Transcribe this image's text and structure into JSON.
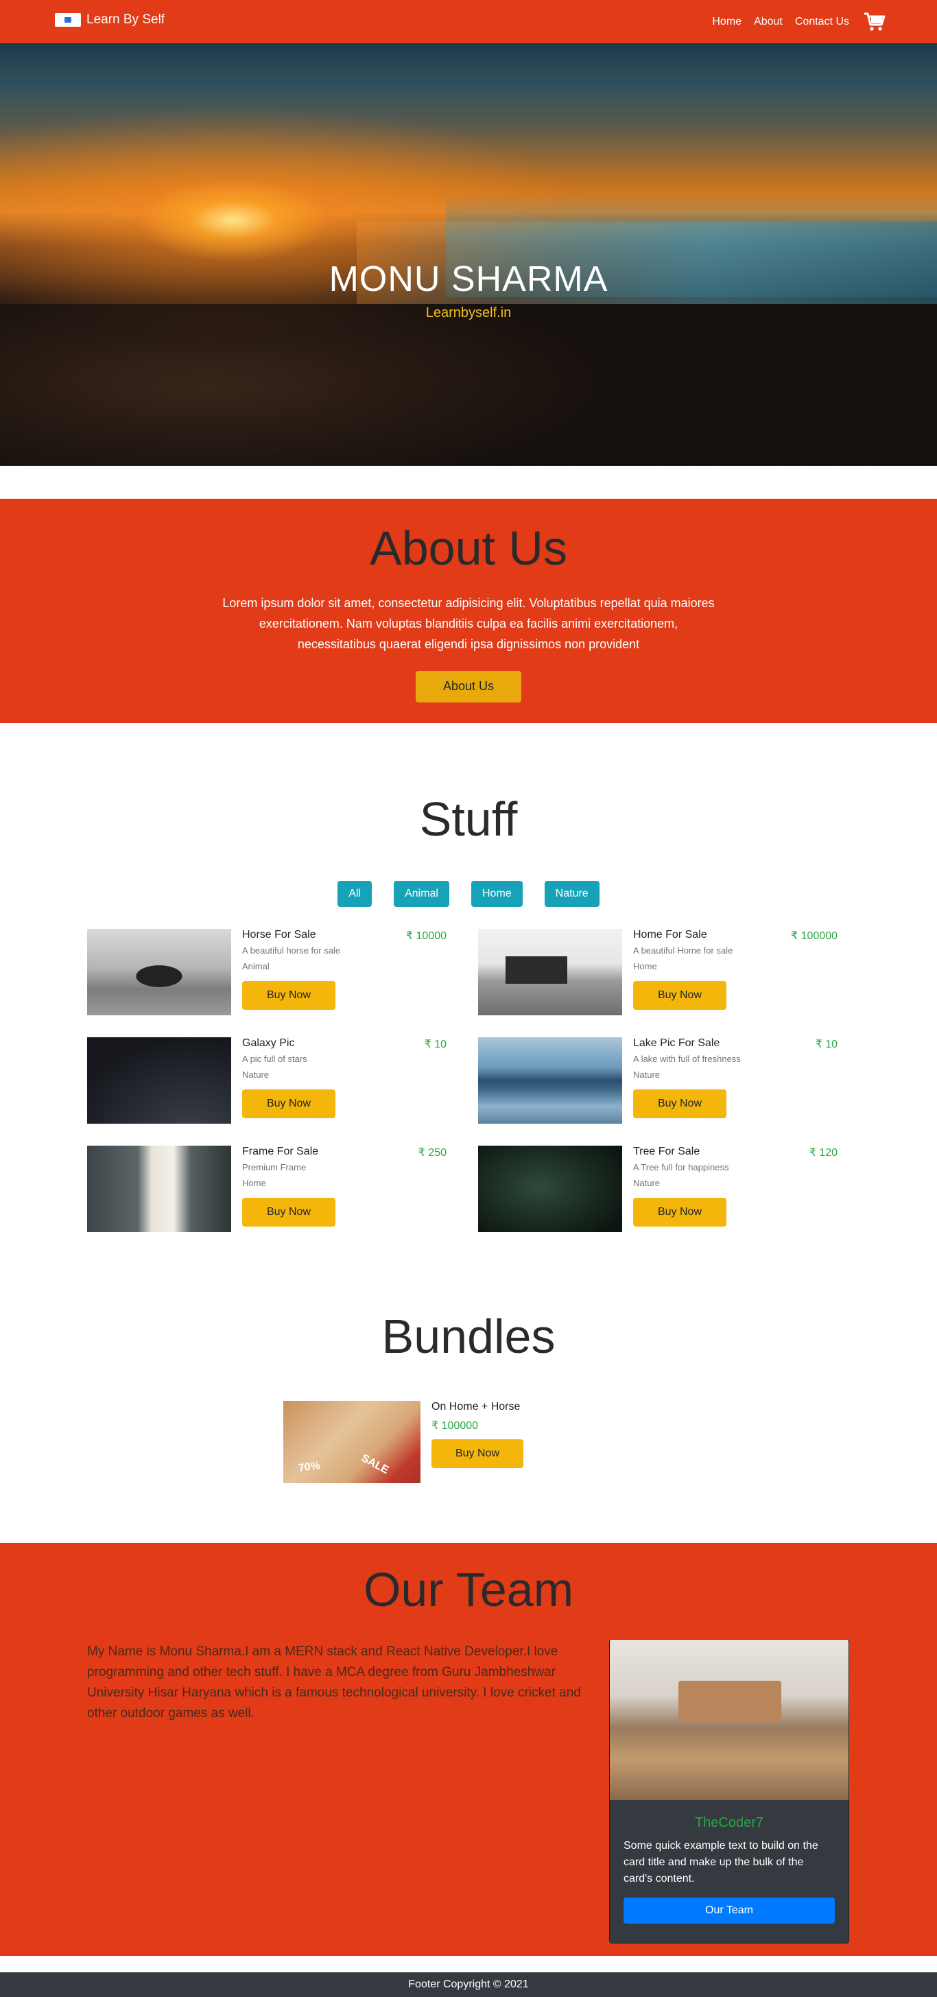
{
  "nav": {
    "brand": "Learn By Self",
    "links": [
      "Home",
      "About",
      "Contact Us"
    ]
  },
  "hero": {
    "title": "MONU SHARMA",
    "subtitle": "Learnbyself.in"
  },
  "about": {
    "title": "About Us",
    "text": "Lorem ipsum dolor sit amet, consectetur adipisicing elit. Voluptatibus repellat quia maiores exercitationem. Nam voluptas blanditiis culpa ea facilis animi exercitationem, necessitatibus quaerat eligendi ipsa dignissimos non provident",
    "button": "About Us"
  },
  "stuff": {
    "title": "Stuff",
    "filters": [
      "All",
      "Animal",
      "Home",
      "Nature"
    ],
    "products": [
      {
        "name": "Horse For Sale",
        "desc": "A beautiful horse for sale",
        "category": "Animal",
        "price": "₹ 10000",
        "button": "Buy Now"
      },
      {
        "name": "Home For Sale",
        "desc": "A beautiful Home for sale",
        "category": "Home",
        "price": "₹ 100000",
        "button": "Buy Now"
      },
      {
        "name": "Galaxy Pic",
        "desc": "A pic full of stars",
        "category": "Nature",
        "price": "₹ 10",
        "button": "Buy Now"
      },
      {
        "name": "Lake Pic For Sale",
        "desc": "A lake with full of freshness",
        "category": "Nature",
        "price": "₹ 10",
        "button": "Buy Now"
      },
      {
        "name": "Frame For Sale",
        "desc": "Premium Frame",
        "category": "Home",
        "price": "₹ 250",
        "button": "Buy Now"
      },
      {
        "name": "Tree For Sale",
        "desc": "A Tree full for happiness",
        "category": "Nature",
        "price": "₹ 120",
        "button": "Buy Now"
      }
    ]
  },
  "bundles": {
    "title": "Bundles",
    "item": {
      "name": "On Home + Horse",
      "price": "₹ 100000",
      "button": "Buy Now",
      "img_tag_1": "70%",
      "img_tag_2": "SALE"
    }
  },
  "team": {
    "title": "Our Team",
    "text": "My Name is Monu Sharma.I am a MERN stack and React Native Developer.I love programming and other tech stuff. I have a MCA degree from Guru Jambheshwar University Hisar Haryana which is a famous technological university. I love cricket and other outdoor games as well.",
    "card": {
      "title": "TheCoder7",
      "text": "Some quick example text to build on the card title and make up the bulk of the card's content.",
      "button": "Our Team"
    }
  },
  "footer": {
    "text": "Footer Copyright © 2021"
  },
  "colors": {
    "primary_bg": "#e13b18",
    "accent_yellow": "#f5b60c",
    "filter_teal": "#17a2b8",
    "price_green": "#28a745",
    "card_dark": "#343a40",
    "button_blue": "#007bff"
  },
  "icons": {
    "brand_logo": "brand-logo-icon",
    "cart": "shopping-cart-icon"
  }
}
